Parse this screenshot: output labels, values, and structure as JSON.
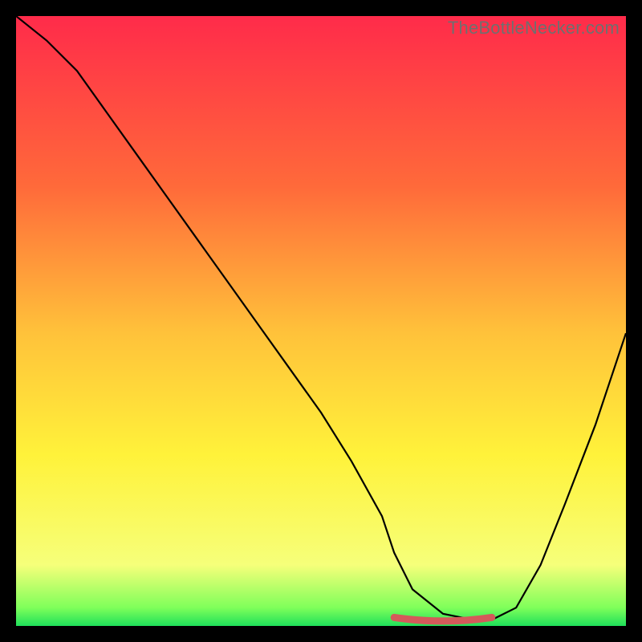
{
  "watermark": "TheBottleNecker.com",
  "colors": {
    "gradient_top": "#ff2b4a",
    "gradient_mid1": "#ff6a3a",
    "gradient_mid2": "#ffc23a",
    "gradient_mid3": "#fff23a",
    "gradient_mid4": "#f6ff7a",
    "gradient_bottom": "#1fe05a",
    "curve": "#000000",
    "valley_marker": "#d45a5a",
    "frame_bg": "#000000"
  },
  "chart_data": {
    "type": "line",
    "title": "",
    "xlabel": "",
    "ylabel": "",
    "xlim": [
      0,
      100
    ],
    "ylim": [
      0,
      100
    ],
    "series": [
      {
        "name": "bottleneck-curve",
        "x": [
          0,
          5,
          10,
          15,
          20,
          25,
          30,
          35,
          40,
          45,
          50,
          55,
          60,
          62,
          65,
          70,
          75,
          78,
          82,
          86,
          90,
          95,
          100
        ],
        "values": [
          100,
          96,
          91,
          84,
          77,
          70,
          63,
          56,
          49,
          42,
          35,
          27,
          18,
          12,
          6,
          2,
          1,
          1,
          3,
          10,
          20,
          33,
          48
        ]
      }
    ],
    "valley_marker": {
      "x_start": 62,
      "x_end": 78,
      "y": 1,
      "note": "flat minimum highlighted in red"
    },
    "background_gradient_stops": [
      {
        "pos": 0.0,
        "color": "#ff2b4a"
      },
      {
        "pos": 0.28,
        "color": "#ff6a3a"
      },
      {
        "pos": 0.52,
        "color": "#ffc23a"
      },
      {
        "pos": 0.72,
        "color": "#fff23a"
      },
      {
        "pos": 0.9,
        "color": "#f6ff7a"
      },
      {
        "pos": 0.97,
        "color": "#7fff5a"
      },
      {
        "pos": 1.0,
        "color": "#1fe05a"
      }
    ]
  }
}
